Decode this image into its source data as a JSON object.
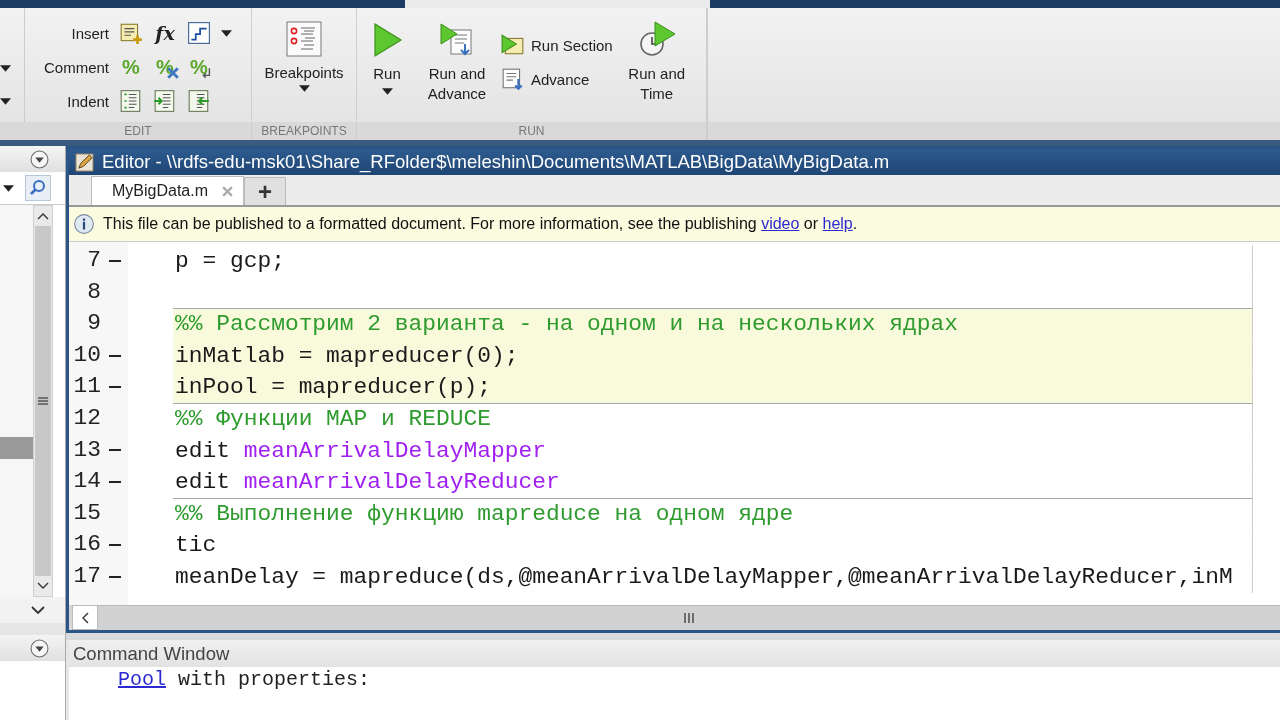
{
  "ribbon": {
    "edit": {
      "label": "EDIT",
      "rows": [
        {
          "label": "Insert",
          "dropdown": true,
          "icons": [
            {
              "kind": "section"
            },
            {
              "kind": "function",
              "glyph": "fx"
            },
            {
              "kind": "stairs"
            }
          ]
        },
        {
          "label": "Comment",
          "dropdown": false,
          "icons": [
            {
              "kind": "comment",
              "glyph": "%"
            },
            {
              "kind": "uncomment",
              "glyph": "%"
            },
            {
              "kind": "wrap",
              "glyph": "%"
            }
          ]
        },
        {
          "label": "Indent",
          "dropdown": false,
          "icons": [
            {
              "kind": "smart-indent"
            },
            {
              "kind": "indent"
            },
            {
              "kind": "outdent"
            }
          ]
        }
      ]
    },
    "breakpoints": {
      "label": "BREAKPOINTS",
      "button": "Breakpoints"
    },
    "run": {
      "label": "RUN",
      "buttons": [
        {
          "kind": "run",
          "label": "Run",
          "dropdown": true
        },
        {
          "kind": "run-advance",
          "label": "Run and Advance",
          "dropdown": false
        },
        {
          "kind": "stack",
          "items": [
            {
              "kind": "run-section",
              "label": "Run Section"
            },
            {
              "kind": "advance",
              "label": "Advance"
            }
          ]
        },
        {
          "kind": "run-time",
          "label": "Run and Time",
          "dropdown": false
        }
      ]
    }
  },
  "editor": {
    "title": "Editor - \\\\rdfs-edu-msk01\\Share_RFolder$\\meleshin\\Documents\\MATLAB\\BigData\\MyBigData.m",
    "tabs": [
      {
        "label": "MyBigData.m",
        "selected": true
      }
    ],
    "new_tab": "+",
    "info": {
      "text": "This file can be published to a formatted document. For more information, see the publishing",
      "link_1": "video",
      "middle": "or",
      "link_2": "help",
      "end": "."
    },
    "lines": [
      {
        "number": "7",
        "executable": true,
        "section_start": false,
        "highlighted": false,
        "parts": [
          {
            "kind": "code",
            "text": "p = gcp;"
          }
        ]
      },
      {
        "number": "8",
        "executable": false,
        "section_start": false,
        "highlighted": false
      },
      {
        "number": "9",
        "executable": false,
        "section_start": true,
        "highlighted": true,
        "parts": [
          {
            "kind": "comment",
            "text": "%% Рассмотрим 2 варианта - на одном и на нескольких ядрах"
          }
        ]
      },
      {
        "number": "10",
        "executable": true,
        "section_start": false,
        "highlighted": true,
        "parts": [
          {
            "kind": "code",
            "text": "inMatlab = mapreducer(0);"
          }
        ]
      },
      {
        "number": "11",
        "executable": true,
        "section_start": false,
        "highlighted": true,
        "parts": [
          {
            "kind": "code",
            "text": "inPool = mapreducer(p);"
          }
        ]
      },
      {
        "number": "12",
        "executable": false,
        "section_start": true,
        "highlighted": false,
        "parts": [
          {
            "kind": "comment",
            "text": "%% Функции MAP и REDUCE"
          }
        ]
      },
      {
        "number": "13",
        "executable": true,
        "section_start": false,
        "highlighted": false,
        "parts": [
          {
            "kind": "code",
            "text": "edit "
          },
          {
            "kind": "string",
            "text": "meanArrivalDelayMapper"
          }
        ]
      },
      {
        "number": "14",
        "executable": true,
        "section_start": false,
        "highlighted": false,
        "parts": [
          {
            "kind": "code",
            "text": "edit "
          },
          {
            "kind": "string",
            "text": "meanArrivalDelayReducer"
          }
        ]
      },
      {
        "number": "15",
        "executable": false,
        "section_start": true,
        "highlighted": false,
        "parts": [
          {
            "kind": "comment",
            "text": "%% Выполнение функцию mapreduce на одном ядре"
          }
        ]
      },
      {
        "number": "16",
        "executable": true,
        "section_start": false,
        "highlighted": false,
        "parts": [
          {
            "kind": "code",
            "text": "tic"
          }
        ]
      },
      {
        "number": "17",
        "executable": true,
        "section_start": false,
        "highlighted": false,
        "parts": [
          {
            "kind": "code",
            "text": "meanDelay = mapreduce(ds,@meanArrivalDelayMapper,@meanArrivalDelayReducer,inM"
          }
        ]
      }
    ]
  },
  "command_window": {
    "title": "Command Window",
    "link": "Pool",
    "text": "with properties:"
  }
}
